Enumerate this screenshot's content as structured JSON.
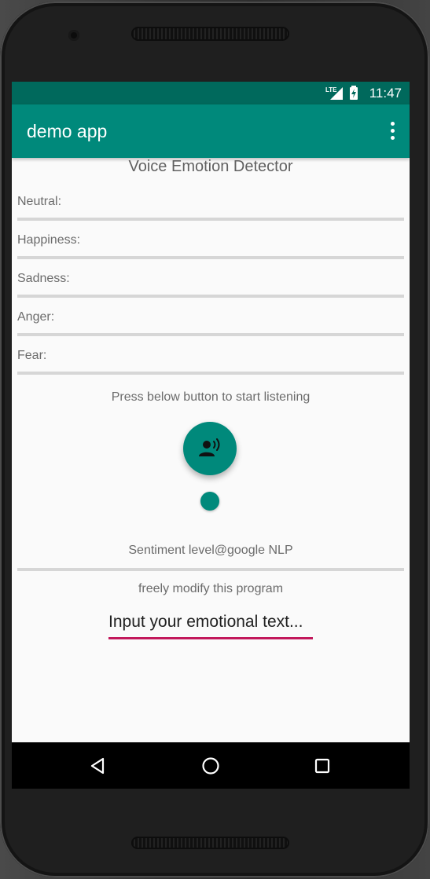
{
  "status_bar": {
    "time": "11:47",
    "network": "LTE"
  },
  "app_bar": {
    "title": "demo app"
  },
  "main": {
    "heading": "Voice Emotion Detector",
    "emotions": [
      {
        "label": "Neutral:",
        "level": 0
      },
      {
        "label": "Happiness:",
        "level": 0
      },
      {
        "label": "Sadness:",
        "level": 0
      },
      {
        "label": "Anger:",
        "level": 0
      },
      {
        "label": "Fear:",
        "level": 0
      }
    ],
    "hint": "Press below button to start listening",
    "fab_icon": "voice-recognition-icon",
    "sentiment_label": "Sentiment level@google NLP",
    "sentiment_level": 0,
    "modify_text": "freely modify this program",
    "input_placeholder": "Input your emotional text..."
  },
  "colors": {
    "primary": "#00897b",
    "primary_dark": "#00695c",
    "accent": "#c2185b"
  }
}
